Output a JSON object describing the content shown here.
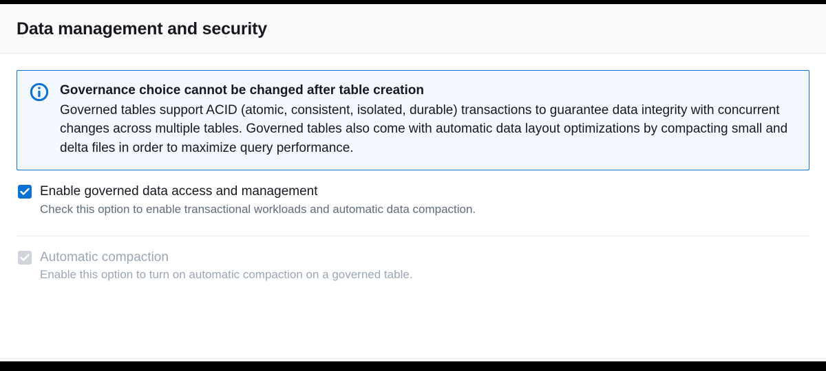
{
  "header": {
    "title": "Data management and security"
  },
  "alert": {
    "heading": "Governance choice cannot be changed after table creation",
    "body": "Governed tables support ACID (atomic, consistent, isolated, durable) transactions to guarantee data integrity with concurrent changes across multiple tables. Governed tables also come with automatic data layout optimizations by compacting small and delta files in order to maximize query performance."
  },
  "options": {
    "governed": {
      "label": "Enable governed data access and management",
      "description": "Check this option to enable transactional workloads and automatic data compaction."
    },
    "compaction": {
      "label": "Automatic compaction",
      "description": "Enable this option to turn on automatic compaction on a governed table."
    }
  }
}
